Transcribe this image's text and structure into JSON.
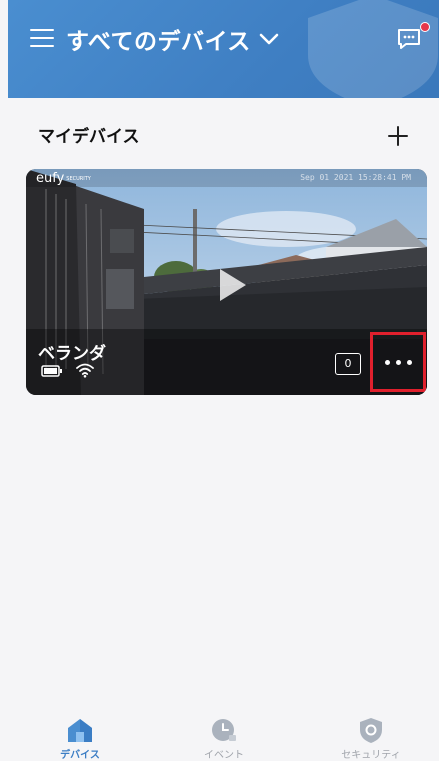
{
  "header": {
    "title": "すべてのデバイス",
    "notification_dot_color": "#e5364a",
    "brand_color": "#3f7fc3"
  },
  "section": {
    "title": "マイデバイス"
  },
  "device_card": {
    "logo_text": "eufy",
    "logo_sub": "SECURITY",
    "timestamp": "Sep 01 2021 15:28:41 PM",
    "device_name": "ベランダ",
    "event_count": "0",
    "icons": [
      "battery-icon",
      "wifi-icon",
      "play-icon",
      "more-icon"
    ],
    "highlight_color": "#e0202d"
  },
  "tabbar": {
    "tabs": [
      {
        "label": "デバイス",
        "icon": "home-icon",
        "active": true
      },
      {
        "label": "イベント",
        "icon": "clock-icon",
        "active": false
      },
      {
        "label": "セキュリティ",
        "icon": "shield-icon",
        "active": false
      }
    ]
  }
}
